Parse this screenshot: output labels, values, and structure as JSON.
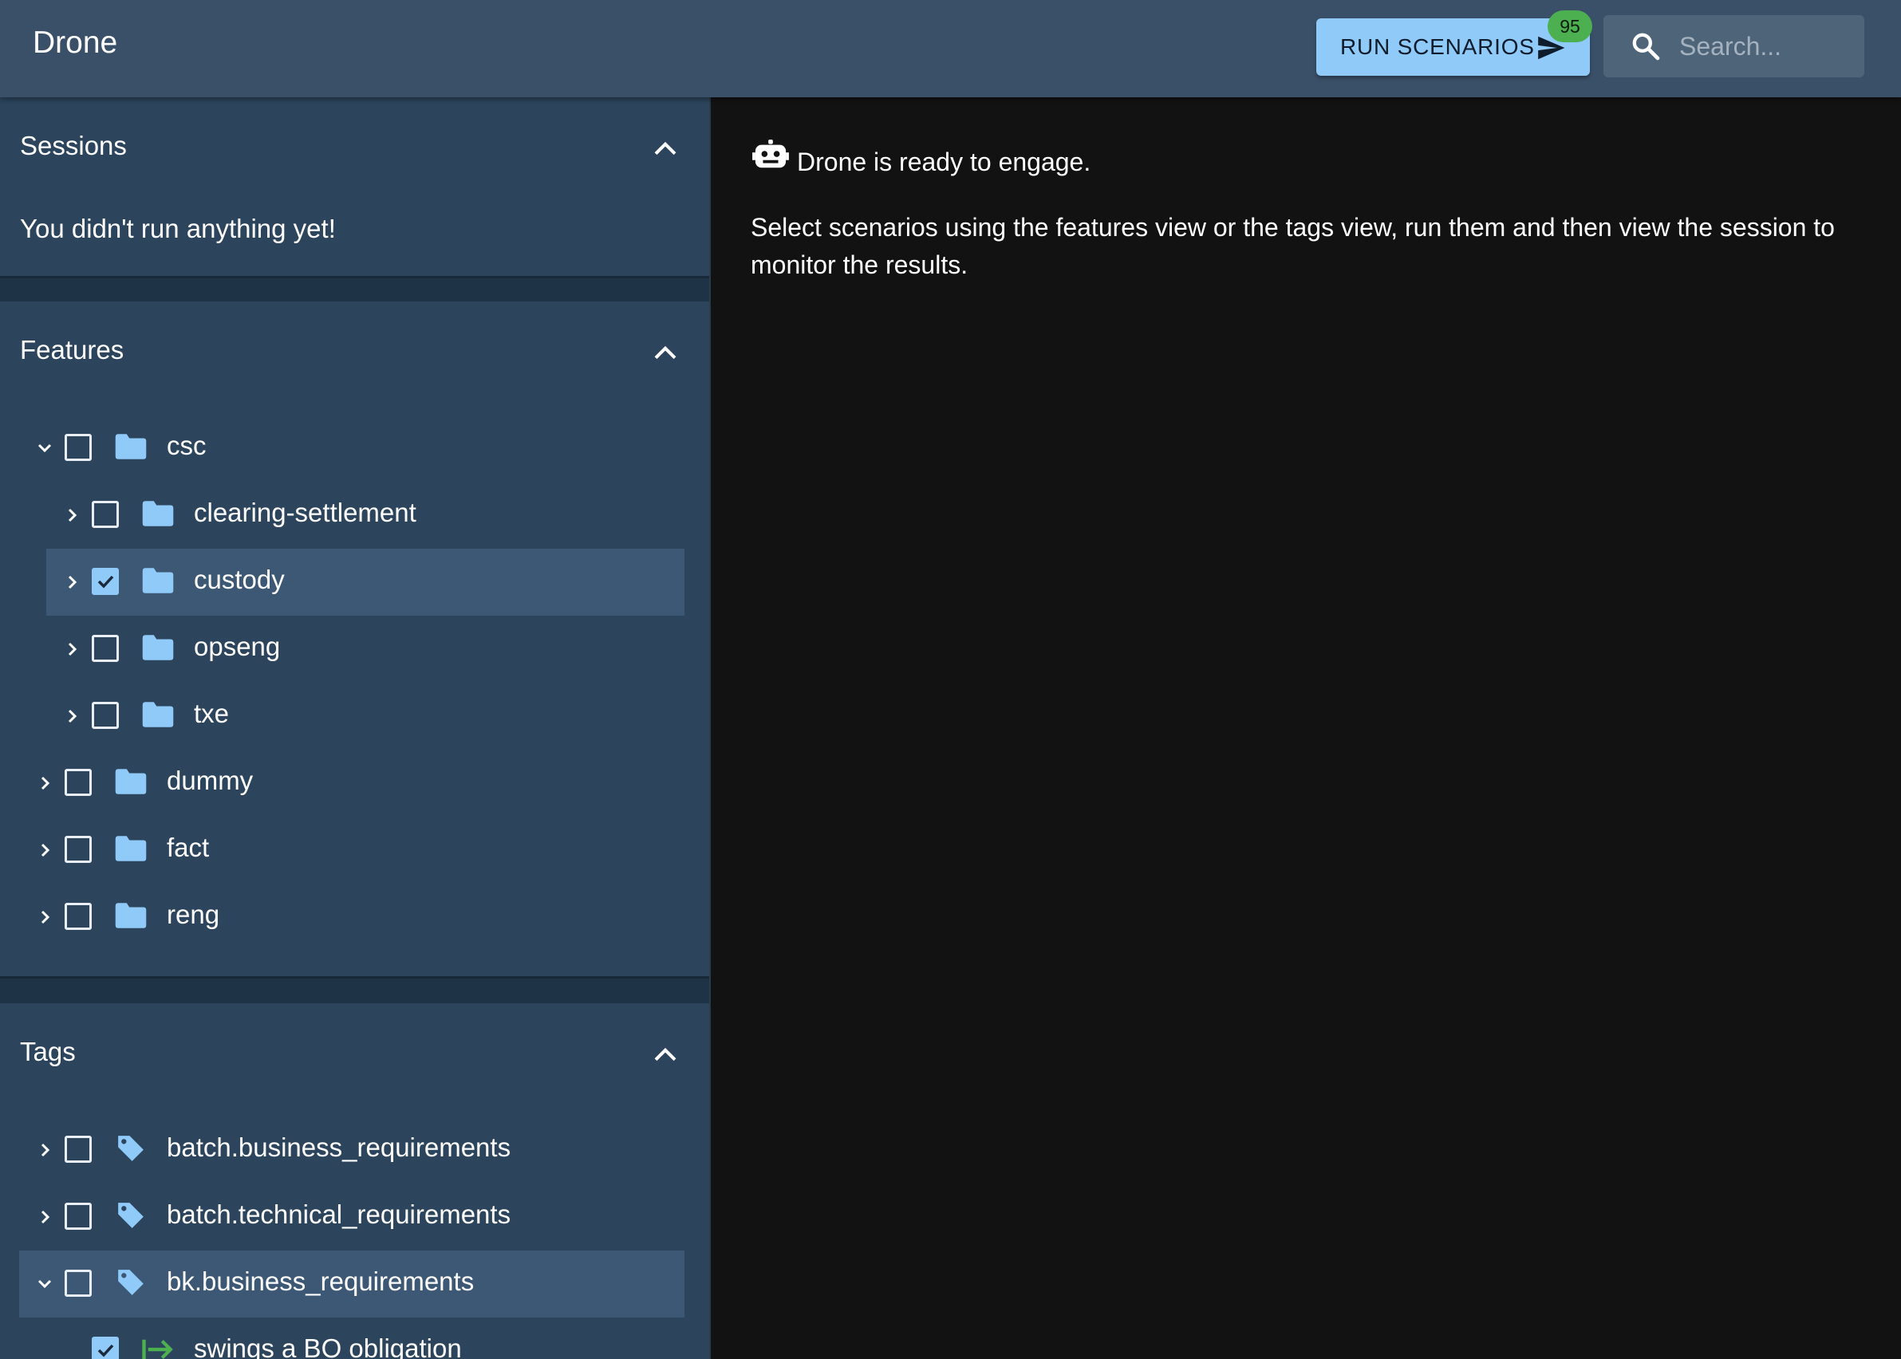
{
  "app": {
    "title": "Drone"
  },
  "toolbar": {
    "run_label": "RUN SCENARIOS",
    "run_badge": "95",
    "search_placeholder": "Search..."
  },
  "sessions": {
    "title": "Sessions",
    "empty_text": "You didn't run anything yet!"
  },
  "features": {
    "title": "Features",
    "items": [
      {
        "label": "csc",
        "depth": 0,
        "expanded": true,
        "checked": false,
        "selected": false
      },
      {
        "label": "clearing-settlement",
        "depth": 1,
        "expanded": false,
        "checked": false,
        "selected": false
      },
      {
        "label": "custody",
        "depth": 1,
        "expanded": false,
        "checked": true,
        "selected": true
      },
      {
        "label": "opseng",
        "depth": 1,
        "expanded": false,
        "checked": false,
        "selected": false
      },
      {
        "label": "txe",
        "depth": 1,
        "expanded": false,
        "checked": false,
        "selected": false
      },
      {
        "label": "dummy",
        "depth": 0,
        "expanded": false,
        "checked": false,
        "selected": false
      },
      {
        "label": "fact",
        "depth": 0,
        "expanded": false,
        "checked": false,
        "selected": false
      },
      {
        "label": "reng",
        "depth": 0,
        "expanded": false,
        "checked": false,
        "selected": false
      }
    ]
  },
  "tags": {
    "title": "Tags",
    "items": [
      {
        "label": "batch.business_requirements",
        "expanded": false,
        "checked": false,
        "selected": false
      },
      {
        "label": "batch.technical_requirements",
        "expanded": false,
        "checked": false,
        "selected": false
      },
      {
        "label": "bk.business_requirements",
        "expanded": true,
        "checked": false,
        "selected": true
      }
    ],
    "scenario": {
      "label": "swings a BO obligation",
      "checked": true
    }
  },
  "main": {
    "ready_text": "Drone is ready to engage.",
    "description": "Select scenarios using the features view or the tags view, run them and then view the session to monitor the results."
  },
  "colors": {
    "appbar": "#3a5068",
    "panel": "#2c455c",
    "selected_row": "#3c5874",
    "accent": "#90caf9",
    "badge": "#4caf50",
    "content_bg": "#121212"
  },
  "icons": {
    "send": "send-icon",
    "search": "search-icon",
    "folder": "folder-icon",
    "tag": "tag-icon",
    "robot": "robot-icon",
    "scenario": "arrow-right-from-bar-icon"
  }
}
